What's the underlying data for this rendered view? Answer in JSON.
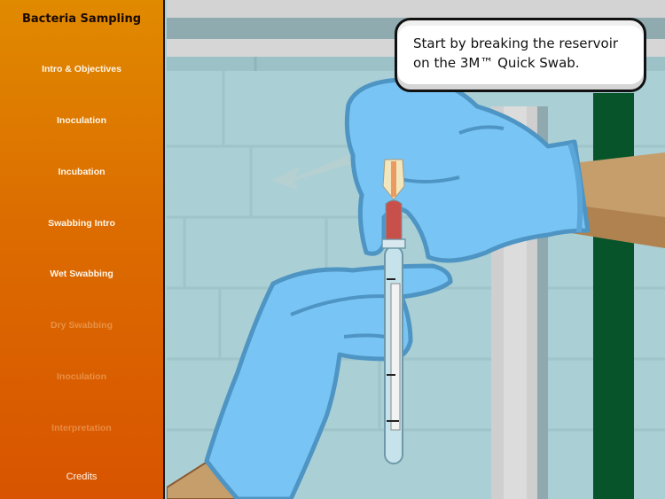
{
  "sidebar": {
    "title": "Bacteria Sampling",
    "items": [
      {
        "label": "Intro & Objectives",
        "state": "enabled"
      },
      {
        "label": "Inoculation",
        "state": "enabled"
      },
      {
        "label": "Incubation",
        "state": "enabled"
      },
      {
        "label": "Swabbing Intro",
        "state": "enabled"
      },
      {
        "label": "Wet Swabbing",
        "state": "enabled"
      },
      {
        "label": "Dry Swabbing",
        "state": "disabled"
      },
      {
        "label": "Inoculation",
        "state": "disabled"
      },
      {
        "label": "Interpretation",
        "state": "disabled"
      },
      {
        "label": "Credits",
        "state": "enabled"
      }
    ]
  },
  "instruction": {
    "text": "Start by breaking the reservoir on the 3M™ Quick Swab."
  },
  "scene": {
    "description": "Gloved hands holding a 3M Quick Swab tube",
    "hint_arrow_direction": "left",
    "colors": {
      "sidebar_top": "#e08a00",
      "sidebar_bottom": "#d85400",
      "wall": "#aacfd5",
      "glove": "#78c4f5",
      "glove_outline": "#4e95c4",
      "pipe_green": "#07532a",
      "skin": "#c59e6c",
      "reservoir_red": "#c8504a"
    }
  }
}
